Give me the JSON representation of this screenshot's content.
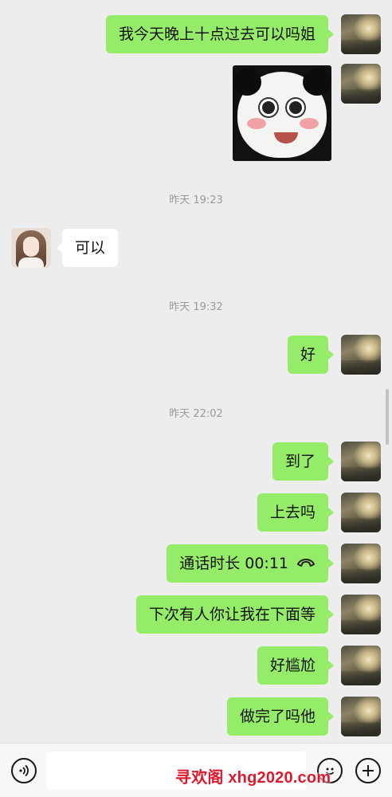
{
  "messages": [
    {
      "type": "text",
      "from": "me",
      "text": "我今天晚上十点过去可以吗姐"
    },
    {
      "type": "sticker",
      "from": "me",
      "sticker": "panda-face-sticker"
    },
    {
      "type": "time",
      "text": "昨天 19:23"
    },
    {
      "type": "text",
      "from": "her",
      "text": "可以"
    },
    {
      "type": "time",
      "text": "昨天 19:32"
    },
    {
      "type": "text",
      "from": "me",
      "text": "好"
    },
    {
      "type": "time",
      "text": "昨天 22:02"
    },
    {
      "type": "text",
      "from": "me",
      "text": "到了"
    },
    {
      "type": "text",
      "from": "me",
      "text": "上去吗"
    },
    {
      "type": "call",
      "from": "me",
      "text": "通话时长 00:11",
      "icon": "phone-hangup-icon"
    },
    {
      "type": "text",
      "from": "me",
      "text": "下次有人你让我在下面等"
    },
    {
      "type": "text",
      "from": "me",
      "text": "好尴尬"
    },
    {
      "type": "text",
      "from": "me",
      "text": "做完了吗他"
    }
  ],
  "input_bar": {
    "voice_icon": "voice-icon",
    "input_value": "",
    "emoji_icon": "emoji-icon",
    "plus_icon": "plus-icon"
  },
  "watermark": "寻欢阁 xhg2020.com",
  "colors": {
    "background": "#ededed",
    "my_bubble": "#95ec69",
    "their_bubble": "#ffffff",
    "timestamp_text": "#9a9a9a",
    "watermark": "#e0182b"
  }
}
